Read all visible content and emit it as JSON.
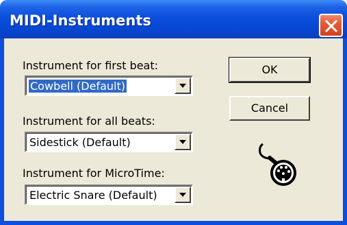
{
  "window": {
    "title": "MIDI-Instruments"
  },
  "fields": {
    "first_beat": {
      "label": "Instrument for first beat:",
      "value": "Cowbell (Default)"
    },
    "all_beats": {
      "label": "Instrument for all beats:",
      "value": "Sidestick (Default)"
    },
    "microtime": {
      "label": "Instrument for MicroTime:",
      "value": "Electric Snare (Default)"
    }
  },
  "buttons": {
    "ok_label": "OK",
    "cancel_label": "Cancel"
  },
  "icons": {
    "close": "close-icon",
    "dropdown": "chevron-down-icon",
    "midi": "midi-plug-icon"
  },
  "colors": {
    "titlebar": "#0a4fdd",
    "dialog_bg": "#ece9d8",
    "selection": "#316ac5",
    "close_button": "#d3431c"
  }
}
